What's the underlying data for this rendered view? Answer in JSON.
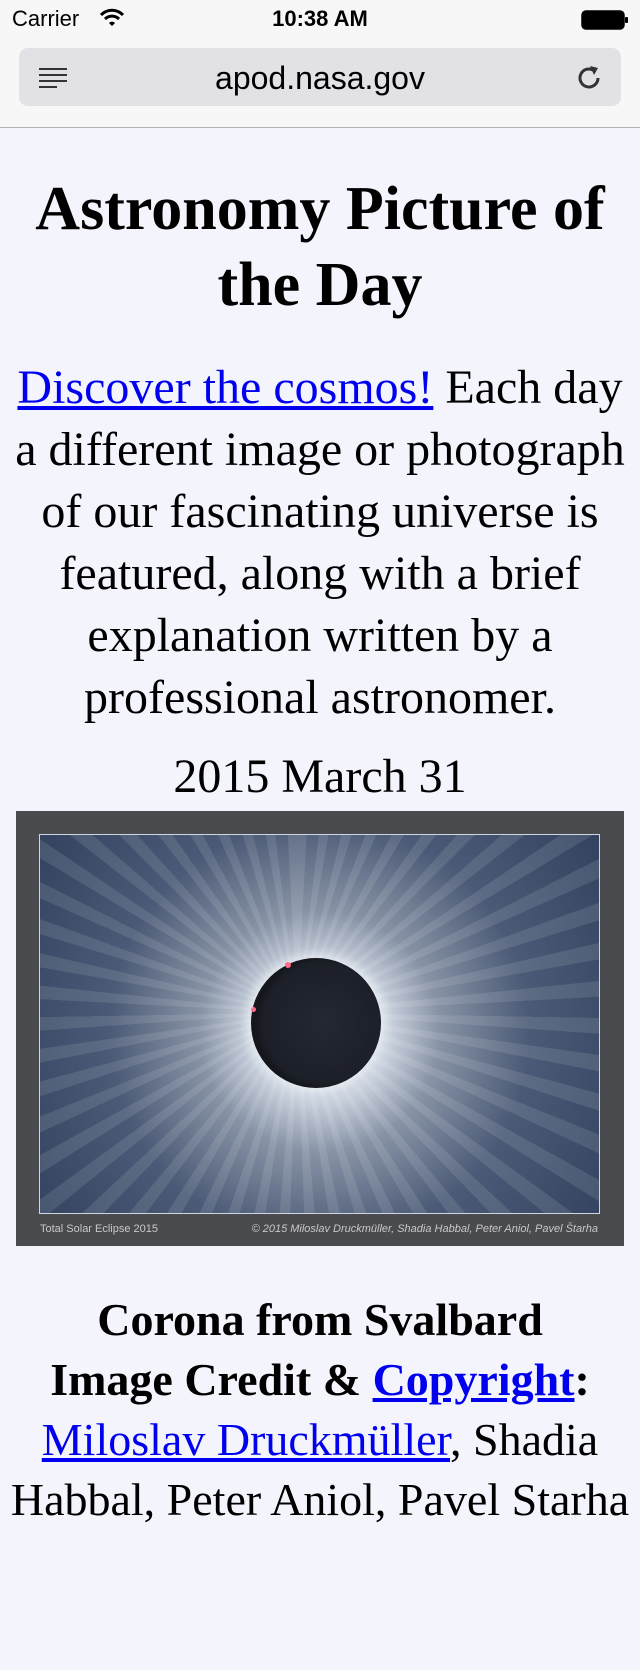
{
  "status": {
    "carrier": "Carrier",
    "time": "10:38 AM",
    "wifi_icon": "wifi-icon",
    "battery_icon": "battery-icon"
  },
  "browser": {
    "url": "apod.nasa.gov",
    "reader_icon": "reader-icon",
    "reload_icon": "reload-icon"
  },
  "page": {
    "title": "Astronomy Picture of the Day",
    "intro_link": "Discover the cosmos!",
    "intro_text": " Each day a different image or photograph of our fascinating universe is featured, along with a brief explanation written by a professional astronomer.",
    "date": "2015 March 31",
    "image": {
      "caption_left": "Total Solar Eclipse 2015",
      "caption_right": "© 2015 Miloslav Druckmüller, Shadia Habbal, Peter Aniol, Pavel Štarha"
    },
    "picture_title": "Corona from Svalbard",
    "credit_prefix": "Image Credit & ",
    "credit_link": "Copyright",
    "credit_colon": ":",
    "author_link": "Miloslav Druckmüller",
    "author_rest": ", Shadia Habbal, Peter Aniol, Pavel Starha"
  }
}
